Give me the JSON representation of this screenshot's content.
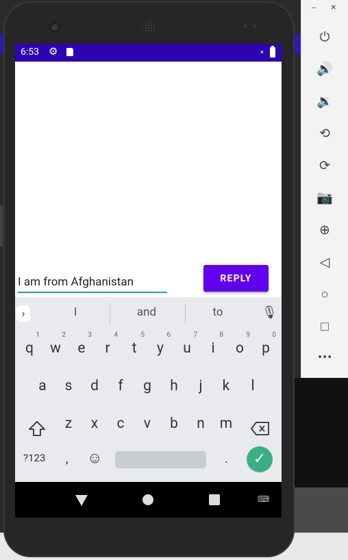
{
  "status_bar": {
    "time": "6:53"
  },
  "app": {
    "message_input": {
      "value": "I am from Afghanistan"
    },
    "reply_button": {
      "label": "REPLY"
    },
    "accent_color": "#6200ee",
    "status_bar_color": "#2d05b0"
  },
  "keyboard": {
    "suggestions": [
      "I",
      "and",
      "to"
    ],
    "row1": [
      {
        "key": "q",
        "hint": "1"
      },
      {
        "key": "w",
        "hint": "2"
      },
      {
        "key": "e",
        "hint": "3"
      },
      {
        "key": "r",
        "hint": "4"
      },
      {
        "key": "t",
        "hint": "5"
      },
      {
        "key": "y",
        "hint": "6"
      },
      {
        "key": "u",
        "hint": "7"
      },
      {
        "key": "i",
        "hint": "8"
      },
      {
        "key": "o",
        "hint": "9"
      },
      {
        "key": "p",
        "hint": "0"
      }
    ],
    "row2": [
      "a",
      "s",
      "d",
      "f",
      "g",
      "h",
      "j",
      "k",
      "l"
    ],
    "row3": [
      "z",
      "x",
      "c",
      "v",
      "b",
      "n",
      "m"
    ],
    "symbols_label": "?123",
    "comma": ",",
    "period": ".",
    "enter_color": "#3aaf86"
  },
  "emulator_toolbar": {
    "minimize": "–",
    "close": "×",
    "icons": [
      "power-icon",
      "volume-up-icon",
      "volume-down-icon",
      "rotate-left-icon",
      "rotate-right-icon",
      "camera-icon",
      "zoom-icon",
      "back-icon",
      "home-icon",
      "overview-icon",
      "more-icon"
    ]
  }
}
